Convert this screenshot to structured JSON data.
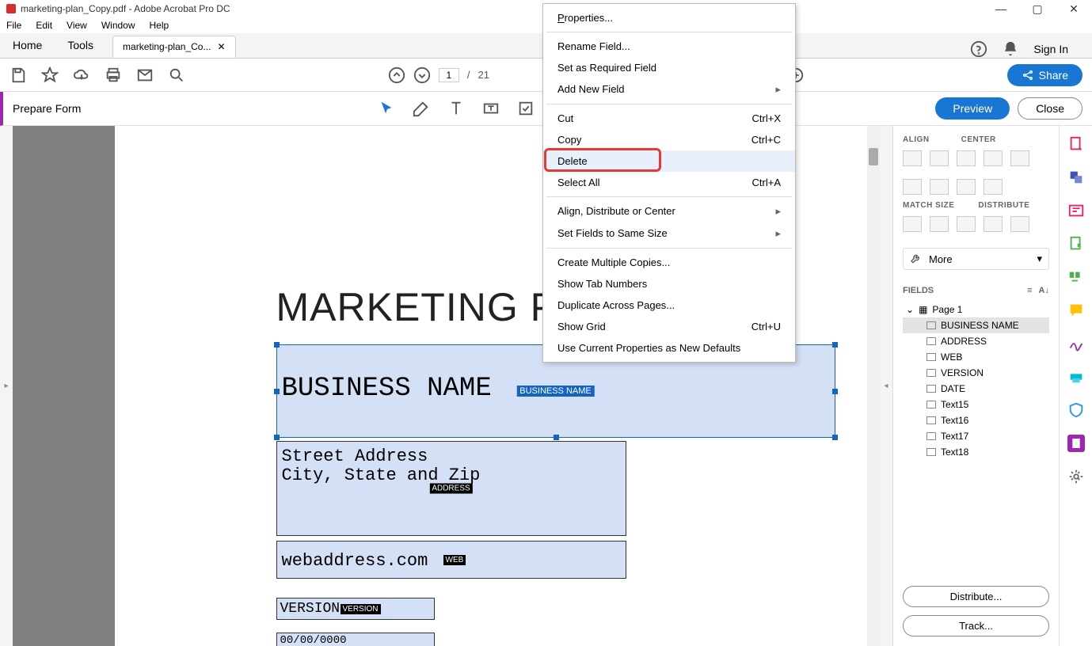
{
  "window": {
    "title": "marketing-plan_Copy.pdf - Adobe Acrobat Pro DC"
  },
  "menubar": {
    "file": "File",
    "edit": "Edit",
    "view": "View",
    "window": "Window",
    "help": "Help"
  },
  "tabs": {
    "home": "Home",
    "tools": "Tools",
    "doc": "marketing-plan_Co...",
    "signin": "Sign In"
  },
  "toolbar": {
    "page_current": "1",
    "page_sep": "/",
    "page_total": "21",
    "share": "Share"
  },
  "formbar": {
    "label": "Prepare Form",
    "preview": "Preview",
    "close": "Close"
  },
  "context_menu": {
    "properties": "Properties...",
    "rename": "Rename Field...",
    "required": "Set as Required Field",
    "addnew": "Add New Field",
    "cut": "Cut",
    "cut_sc": "Ctrl+X",
    "copy": "Copy",
    "copy_sc": "Ctrl+C",
    "delete": "Delete",
    "selectall": "Select All",
    "selectall_sc": "Ctrl+A",
    "align": "Align, Distribute or Center",
    "samesize": "Set Fields to Same Size",
    "multiple": "Create Multiple Copies...",
    "tabnums": "Show Tab Numbers",
    "duplicate": "Duplicate Across Pages...",
    "showgrid": "Show Grid",
    "showgrid_sc": "Ctrl+U",
    "defaults": "Use Current Properties as New Defaults"
  },
  "doc": {
    "title": "MARKETING PLAN",
    "business_name_text": "BUSINESS NAME",
    "business_name_tag": "BUSINESS NAME",
    "street": "Street Address",
    "city": "City, State and Zip",
    "address_tag": "ADDRESS",
    "web_text": "webaddress.com",
    "web_tag": "WEB",
    "version_text": "VERSION",
    "version_tag": "VERSION",
    "date_text": "00/00/0000"
  },
  "panel": {
    "align": "ALIGN",
    "center": "CENTER",
    "match": "MATCH SIZE",
    "distribute": "DISTRIBUTE",
    "more": "More",
    "fields": "FIELDS",
    "page1": "Page 1",
    "items": [
      "BUSINESS NAME",
      "ADDRESS",
      "WEB",
      "VERSION",
      "DATE",
      "Text15",
      "Text16",
      "Text17",
      "Text18"
    ],
    "distribute_btn": "Distribute...",
    "track_btn": "Track..."
  }
}
